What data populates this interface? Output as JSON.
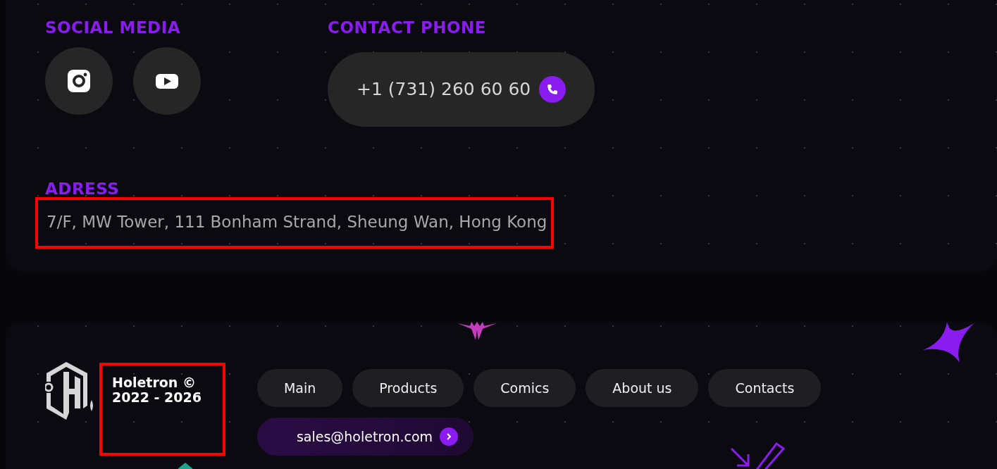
{
  "contacts": {
    "social": {
      "heading": "SOCIAL MEDIA",
      "links": [
        {
          "kind": "instagram"
        },
        {
          "kind": "youtube"
        }
      ]
    },
    "phone": {
      "heading": "CONTACT PHONE",
      "number": "+1 (731) 260 60 60"
    },
    "address": {
      "heading": "ADRESS",
      "text": "7/F, MW Tower, 111 Bonham Strand, Sheung Wan, Hong Kong",
      "highlighted": true
    }
  },
  "footer": {
    "copyright": {
      "lines": [
        "Holetron ©",
        "2022 - 2026"
      ],
      "highlighted": true
    },
    "nav": [
      {
        "label": "Main"
      },
      {
        "label": "Products"
      },
      {
        "label": "Comics"
      },
      {
        "label": "About us"
      },
      {
        "label": "Contacts"
      }
    ],
    "email": "sales@holetron.com"
  }
}
